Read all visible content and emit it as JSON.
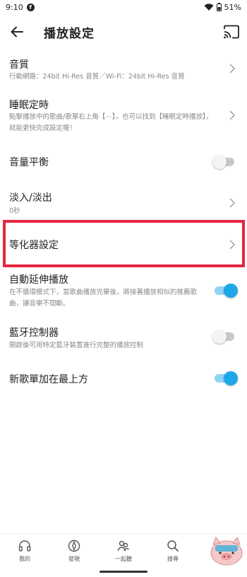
{
  "status": {
    "time": "9:10",
    "fb": "f",
    "battery": "51%"
  },
  "header": {
    "title": "播放設定"
  },
  "settings": {
    "quality": {
      "label": "音質",
      "sub": "行動網路：24bit Hi-Res 音質／Wi-Fi：24bit Hi-Res 音質"
    },
    "sleep": {
      "label": "睡眠定時",
      "sub": "點擊播放中的歌曲/歌單右上角【⋯】，也可以找到【睡眠定時播放】，就能更快完成設定喔！"
    },
    "balance": {
      "label": "音量平衡",
      "enabled": false
    },
    "fade": {
      "label": "淡入/淡出",
      "sub": "0秒"
    },
    "equalizer": {
      "label": "等化器設定"
    },
    "autoplay": {
      "label": "自動延伸播放",
      "sub": "在不循環模式下，當歌曲播放完畢後，將接著播放相似的推薦歌曲，讓音樂不間斷。",
      "enabled": true
    },
    "bluetooth": {
      "label": "藍牙控制器",
      "sub": "開啟後可用特定藍牙裝置進行完整的播放控制",
      "enabled": false
    },
    "newtop": {
      "label": "新歌單加在最上方",
      "enabled": true
    }
  },
  "nav": [
    {
      "label": "我的",
      "icon": "headphones-icon"
    },
    {
      "label": "發現",
      "icon": "compass-icon"
    },
    {
      "label": "一起聽",
      "icon": "people-icon"
    },
    {
      "label": "搜尋",
      "icon": "search-icon"
    },
    {
      "label": "",
      "icon": "more-icon"
    }
  ],
  "colors": {
    "accent": "#1ea7e8",
    "highlight": "#e8263f"
  }
}
